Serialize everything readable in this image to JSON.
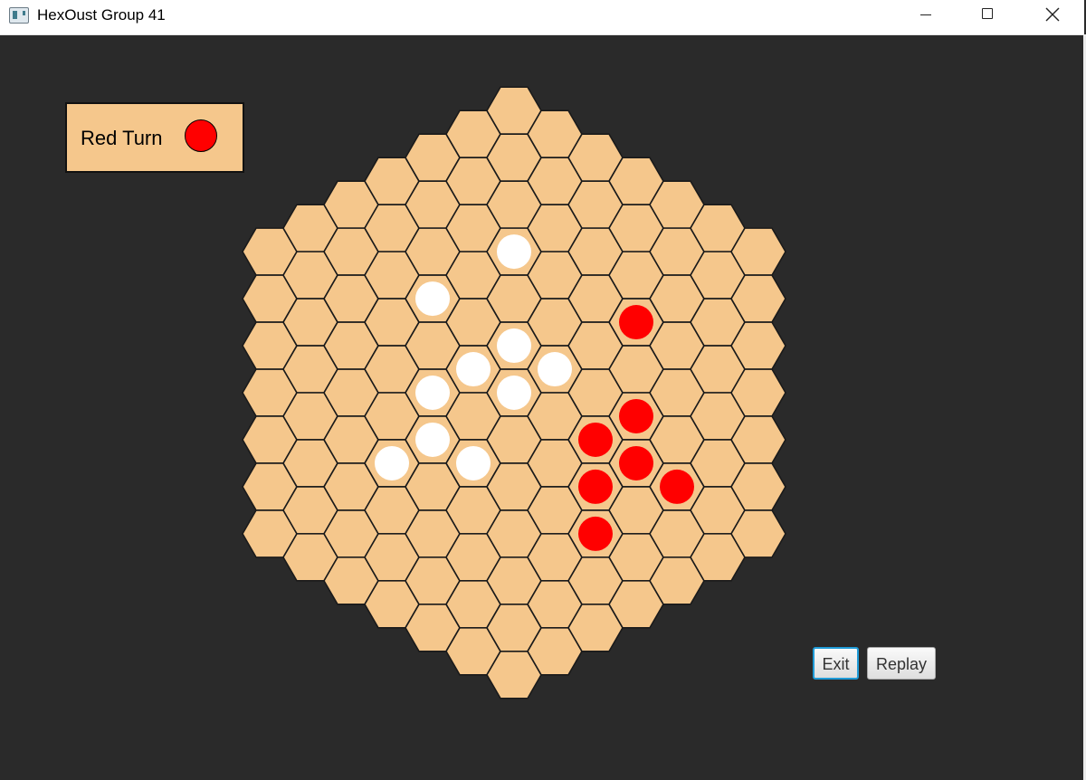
{
  "window": {
    "title": "HexOust Group 41",
    "controls": [
      "minimize",
      "maximize",
      "close"
    ]
  },
  "turn": {
    "label": "Red Turn",
    "current_player": "red"
  },
  "colors": {
    "background": "#2a2a2a",
    "hex_fill": "#f5c78c",
    "hex_stroke": "#1a1a1a",
    "red": "#ff0000",
    "white": "#ffffff"
  },
  "board": {
    "radius": 6,
    "pieces": [
      {
        "q": 0,
        "r": -3,
        "color": "white"
      },
      {
        "q": -2,
        "r": -1,
        "color": "white"
      },
      {
        "q": 3,
        "r": -3,
        "color": "red"
      },
      {
        "q": 0,
        "r": -1,
        "color": "white"
      },
      {
        "q": -1,
        "r": 0,
        "color": "white"
      },
      {
        "q": 1,
        "r": -1,
        "color": "white"
      },
      {
        "q": -2,
        "r": 1,
        "color": "white"
      },
      {
        "q": 0,
        "r": 0,
        "color": "white"
      },
      {
        "q": 3,
        "r": -1,
        "color": "red"
      },
      {
        "q": -2,
        "r": 2,
        "color": "white"
      },
      {
        "q": 2,
        "r": 0,
        "color": "red"
      },
      {
        "q": -3,
        "r": 3,
        "color": "white"
      },
      {
        "q": -1,
        "r": 2,
        "color": "white"
      },
      {
        "q": 3,
        "r": 0,
        "color": "red"
      },
      {
        "q": 2,
        "r": 1,
        "color": "red"
      },
      {
        "q": 4,
        "r": 0,
        "color": "red"
      },
      {
        "q": 2,
        "r": 2,
        "color": "red"
      }
    ]
  },
  "buttons": {
    "exit": "Exit",
    "replay": "Replay"
  }
}
